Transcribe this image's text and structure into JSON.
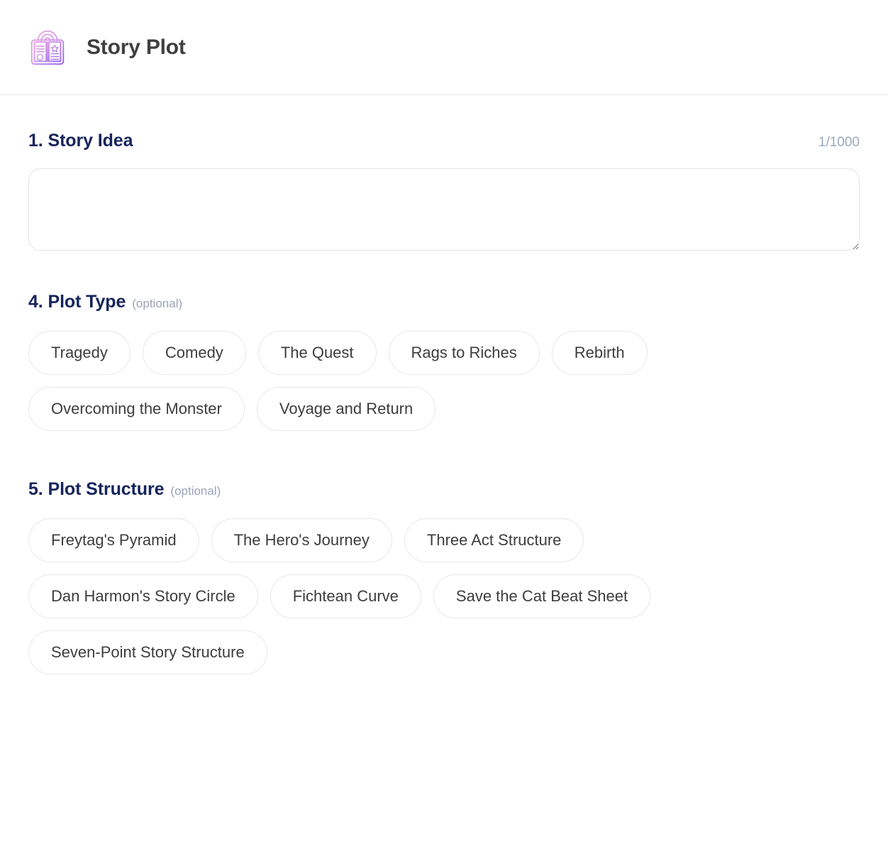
{
  "header": {
    "title": "Story Plot",
    "icon": "story-book-icon",
    "icon_gradient_from": "#f0a8d8",
    "icon_gradient_to": "#9b6dff"
  },
  "theme": {
    "section_title_color": "#16245c",
    "optional_color": "#9aa3b5",
    "counter_color": "#9aa7bd",
    "chip_border_color": "#e6e7e9",
    "chip_text_color": "#3d3d3d",
    "divider_color": "#e5e7eb"
  },
  "sections": {
    "story_idea": {
      "title": "1. Story Idea",
      "counter": "1/1000",
      "textarea_value": "",
      "textarea_placeholder": ""
    },
    "plot_type": {
      "title": "4. Plot Type",
      "optional_label": "(optional)",
      "options": [
        "Tragedy",
        "Comedy",
        "The Quest",
        "Rags to Riches",
        "Rebirth",
        "Overcoming the Monster",
        "Voyage and Return"
      ],
      "selected": null
    },
    "plot_structure": {
      "title": "5. Plot Structure",
      "optional_label": "(optional)",
      "options": [
        "Freytag's Pyramid",
        "The Hero's Journey",
        "Three Act Structure",
        "Dan Harmon's Story Circle",
        "Fichtean Curve",
        "Save the Cat Beat Sheet",
        "Seven-Point Story Structure"
      ],
      "selected": null
    }
  }
}
